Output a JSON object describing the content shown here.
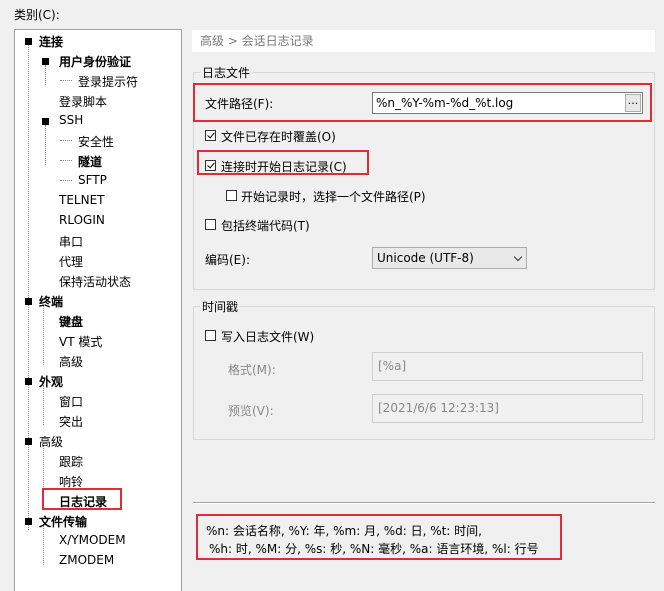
{
  "category_label": "类别(C):",
  "tree": {
    "connection": "连接",
    "auth": "用户身份验证",
    "login_prompt": "登录提示符",
    "login_script": "登录脚本",
    "ssh": "SSH",
    "security": "安全性",
    "tunnel": "隧道",
    "sftp": "SFTP",
    "telnet": "TELNET",
    "rlogin": "RLOGIN",
    "serial": "串口",
    "proxy": "代理",
    "keepalive": "保持活动状态",
    "terminal": "终端",
    "keyboard": "键盘",
    "vt_mode": "VT 模式",
    "terminal_advanced": "高级",
    "appearance": "外观",
    "window": "窗口",
    "highlight": "突出",
    "advanced": "高级",
    "trace": "跟踪",
    "bell": "响铃",
    "logging": "日志记录",
    "file_transfer": "文件传输",
    "xymodem": "X/YMODEM",
    "zmodem": "ZMODEM"
  },
  "breadcrumb": "高级 > 会话日志记录",
  "log_file": {
    "group_title": "日志文件",
    "path_label": "文件路径(F):",
    "path_value": "%n_%Y-%m-%d_%t.log",
    "browse_label": "...",
    "overwrite_label": "文件已存在时覆盖(O)",
    "overwrite_checked": true,
    "start_on_connect_label": "连接时开始日志记录(C)",
    "start_on_connect_checked": true,
    "choose_path_label": "开始记录时，选择一个文件路径(P)",
    "choose_path_checked": false,
    "include_terminal_codes_label": "包括终端代码(T)",
    "include_terminal_codes_checked": false,
    "encoding_label": "编码(E):",
    "encoding_value": "Unicode (UTF-8)"
  },
  "timestamp": {
    "group_title": "时间戳",
    "write_label": "写入日志文件(W)",
    "write_checked": false,
    "format_label": "格式(M):",
    "format_value": "[%a]",
    "preview_label": "预览(V):",
    "preview_value": "[2021/6/6 12:23:13]"
  },
  "help": {
    "line1": "%n: 会话名称, %Y: 年, %m: 月, %d: 日, %t: 时间,",
    "line2": "%h: 时, %M: 分, %s: 秒, %N: 毫秒, %a: 语言环境, %l: 行号"
  },
  "colors": {
    "highlight_red": "#e32b35"
  }
}
